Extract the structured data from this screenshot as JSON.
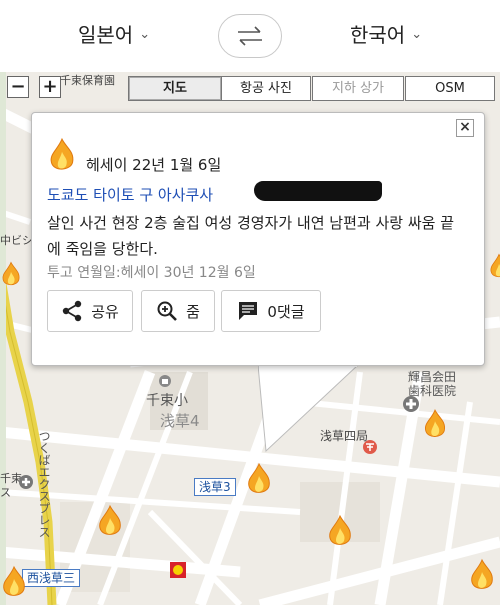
{
  "translate_bar": {
    "source_lang": "일본어",
    "target_lang": "한국어"
  },
  "map_controls": {
    "zoom_out": "−",
    "zoom_in": "+",
    "tabs": [
      {
        "label": "지도",
        "state": "active"
      },
      {
        "label": "항공 사진",
        "state": "normal"
      },
      {
        "label": "지하 상가",
        "state": "disabled"
      },
      {
        "label": "OSM",
        "state": "normal"
      }
    ]
  },
  "map_labels": {
    "nursery": "千束保育園",
    "school": "千束小",
    "district4": "浅草4",
    "district3": "浅草3",
    "postoffice": "浅草四局",
    "clinic_line1": "輝昌会田",
    "clinic_line2": "歯科医院",
    "station_west": "西浅草三",
    "road_vertical": "つくばエクスプレス",
    "nakabishi": "中ビシ",
    "senzoku": "千束",
    "sobu": "ス"
  },
  "popup": {
    "date": "헤세이 22년 1월 6일",
    "address": "도쿄도 타이토 구 아사쿠사 ",
    "description": "살인 사건 현장 2층 술집 여성 경영자가 내연 남편과 사랑 싸움 끝에 죽임을 당한다.",
    "post_date": "투고 연월일:헤세이 30년 12월 6일",
    "buttons": {
      "share": "공유",
      "zoom": "줌",
      "comments": "0댓글"
    },
    "close": "×"
  },
  "colors": {
    "flame_outer": "#f5a623",
    "flame_inner": "#ffe066",
    "rail": "#e8d34a",
    "link": "#1f4fb5"
  }
}
